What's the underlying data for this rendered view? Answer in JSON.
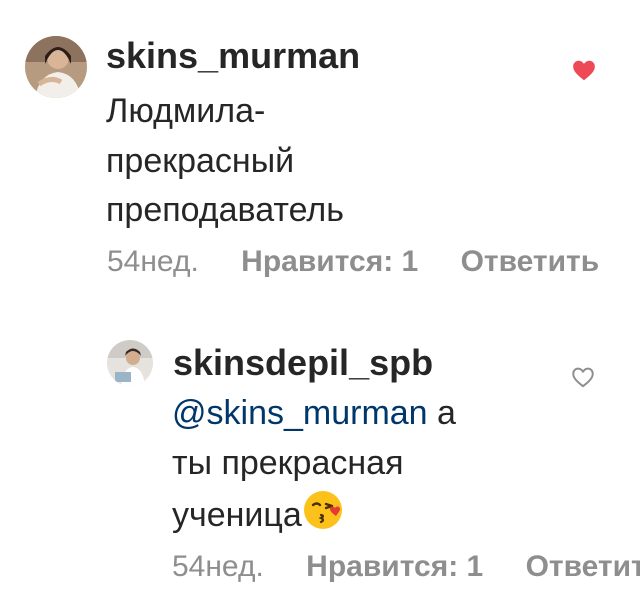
{
  "comments": [
    {
      "username": "skins_murman",
      "text": [
        "Людмила-",
        "прекрасный",
        "преподаватель"
      ],
      "time": "54нед.",
      "likes": "Нравится: 1",
      "reply": "Ответить",
      "liked": true,
      "like_icon": "heart-filled-icon",
      "like_color": "#ed4956"
    },
    {
      "username": "skinsdepil_spb",
      "mention": "@skins_murman",
      "text_after_mention": " а",
      "text": [
        "ты прекрасная",
        "ученица"
      ],
      "emoji": "kissing-face-icon",
      "time": "54нед.",
      "likes": "Нравится: 1",
      "reply": "Ответить",
      "liked": false,
      "like_icon": "heart-outline-icon",
      "like_color": "#8e8e8e"
    }
  ]
}
